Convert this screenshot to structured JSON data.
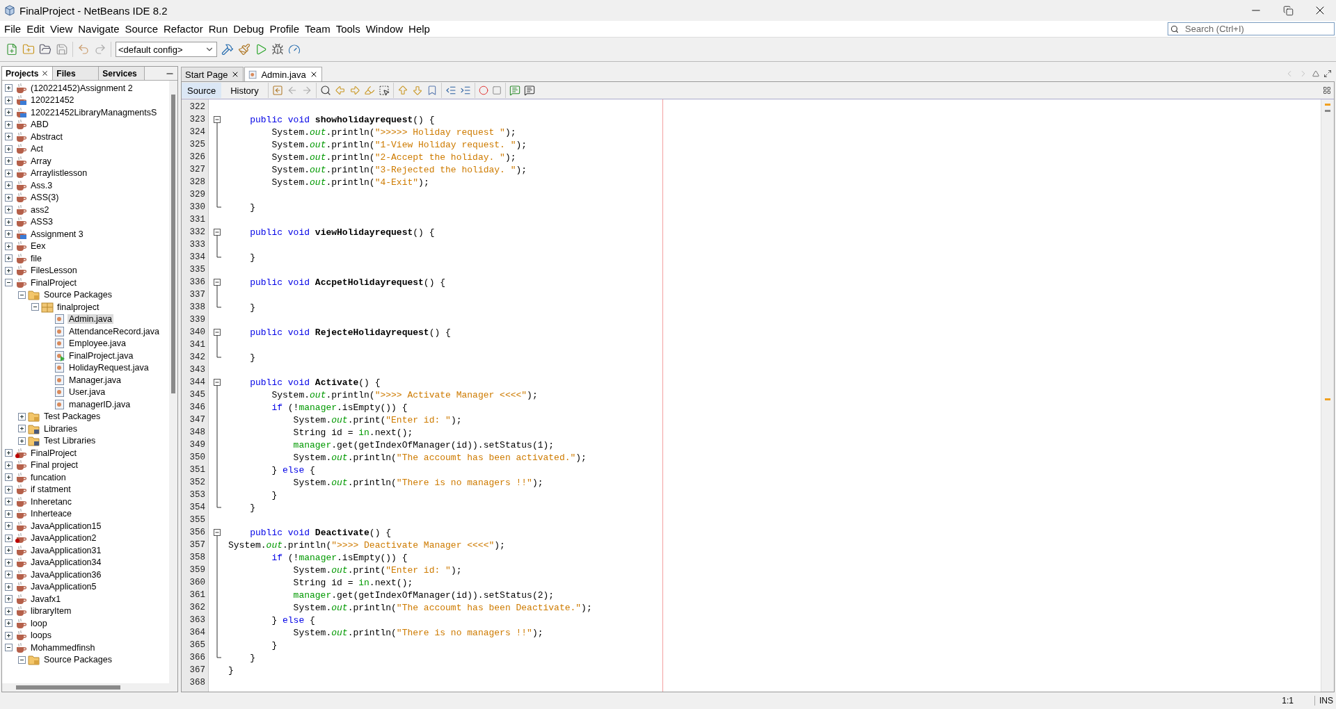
{
  "window": {
    "title": "FinalProject - NetBeans IDE 8.2"
  },
  "menu": [
    "File",
    "Edit",
    "View",
    "Navigate",
    "Source",
    "Refactor",
    "Run",
    "Debug",
    "Profile",
    "Team",
    "Tools",
    "Window",
    "Help"
  ],
  "search": {
    "placeholder": "Search (Ctrl+I)"
  },
  "toolbar": {
    "config": "<default config>"
  },
  "side_tabs": [
    {
      "label": "Projects",
      "selected": true,
      "closable": true
    },
    {
      "label": "Files",
      "selected": false,
      "closable": false
    },
    {
      "label": "Services",
      "selected": false,
      "closable": false
    }
  ],
  "tree": [
    {
      "label": "(120221452)Assignment 2",
      "kind": "project",
      "expanded": false,
      "selected": false
    },
    {
      "label": "120221452",
      "kind": "project-fx",
      "expanded": false,
      "selected": false
    },
    {
      "label": "120221452LibraryManagmentsS",
      "kind": "project-fx",
      "expanded": false,
      "selected": false
    },
    {
      "label": "ABD",
      "kind": "project",
      "expanded": false,
      "selected": false
    },
    {
      "label": "Abstract",
      "kind": "project",
      "expanded": false,
      "selected": false
    },
    {
      "label": "Act",
      "kind": "project",
      "expanded": false,
      "selected": false
    },
    {
      "label": "Array",
      "kind": "project",
      "expanded": false,
      "selected": false
    },
    {
      "label": "Arraylistlesson",
      "kind": "project",
      "expanded": false,
      "selected": false
    },
    {
      "label": "Ass.3",
      "kind": "project",
      "expanded": false,
      "selected": false
    },
    {
      "label": "ASS(3)",
      "kind": "project",
      "expanded": false,
      "selected": false
    },
    {
      "label": "ass2",
      "kind": "project",
      "expanded": false,
      "selected": false
    },
    {
      "label": "ASS3",
      "kind": "project",
      "expanded": false,
      "selected": false
    },
    {
      "label": "Assignment 3",
      "kind": "project-fx",
      "expanded": false,
      "selected": false
    },
    {
      "label": "Eex",
      "kind": "project",
      "expanded": false,
      "selected": false
    },
    {
      "label": "file",
      "kind": "project",
      "expanded": false,
      "selected": false
    },
    {
      "label": "FilesLesson",
      "kind": "project",
      "expanded": false,
      "selected": false
    },
    {
      "label": "FinalProject",
      "kind": "project",
      "expanded": true,
      "selected": false,
      "children": [
        {
          "label": "Source Packages",
          "kind": "source-folder",
          "expanded": true,
          "selected": false,
          "children": [
            {
              "label": "finalproject",
              "kind": "package",
              "expanded": true,
              "selected": false,
              "children": [
                {
                  "label": "Admin.java",
                  "kind": "java-file",
                  "selected": true
                },
                {
                  "label": "AttendanceRecord.java",
                  "kind": "java-file",
                  "selected": false
                },
                {
                  "label": "Employee.java",
                  "kind": "java-file",
                  "selected": false
                },
                {
                  "label": "FinalProject.java",
                  "kind": "main-file",
                  "selected": false
                },
                {
                  "label": "HolidayRequest.java",
                  "kind": "java-file",
                  "selected": false
                },
                {
                  "label": "Manager.java",
                  "kind": "java-file",
                  "selected": false
                },
                {
                  "label": "User.java",
                  "kind": "java-file",
                  "selected": false
                },
                {
                  "label": "managerID.java",
                  "kind": "java-file",
                  "selected": false
                }
              ]
            }
          ]
        },
        {
          "label": "Test Packages",
          "kind": "source-folder",
          "expanded": false,
          "selected": false
        },
        {
          "label": "Libraries",
          "kind": "library-folder",
          "expanded": false,
          "selected": false
        },
        {
          "label": "Test Libraries",
          "kind": "library-folder",
          "expanded": false,
          "selected": false
        }
      ]
    },
    {
      "label": "FinalProject",
      "kind": "project-error",
      "expanded": false,
      "selected": false
    },
    {
      "label": "Final project",
      "kind": "project",
      "expanded": false,
      "selected": false
    },
    {
      "label": "funcation",
      "kind": "project",
      "expanded": false,
      "selected": false
    },
    {
      "label": "if statment",
      "kind": "project",
      "expanded": false,
      "selected": false
    },
    {
      "label": "Inheretanc",
      "kind": "project",
      "expanded": false,
      "selected": false
    },
    {
      "label": "Inherteace",
      "kind": "project",
      "expanded": false,
      "selected": false
    },
    {
      "label": "JavaApplication15",
      "kind": "project",
      "expanded": false,
      "selected": false
    },
    {
      "label": "JavaApplication2",
      "kind": "project-error",
      "expanded": false,
      "selected": false
    },
    {
      "label": "JavaApplication31",
      "kind": "project",
      "expanded": false,
      "selected": false
    },
    {
      "label": "JavaApplication34",
      "kind": "project",
      "expanded": false,
      "selected": false
    },
    {
      "label": "JavaApplication36",
      "kind": "project",
      "expanded": false,
      "selected": false
    },
    {
      "label": "JavaApplication5",
      "kind": "project",
      "expanded": false,
      "selected": false
    },
    {
      "label": "Javafx1",
      "kind": "project",
      "expanded": false,
      "selected": false
    },
    {
      "label": "libraryItem",
      "kind": "project",
      "expanded": false,
      "selected": false
    },
    {
      "label": "loop",
      "kind": "project",
      "expanded": false,
      "selected": false
    },
    {
      "label": "loops",
      "kind": "project",
      "expanded": false,
      "selected": false
    },
    {
      "label": "Mohammedfinsh",
      "kind": "project",
      "expanded": true,
      "selected": false,
      "children": [
        {
          "label": "Source Packages",
          "kind": "source-folder",
          "expanded": true,
          "selected": false
        }
      ]
    }
  ],
  "editor_tabs": [
    {
      "label": "Start Page",
      "selected": false,
      "kind": "page"
    },
    {
      "label": "Admin.java",
      "selected": true,
      "kind": "java"
    }
  ],
  "view_toggles": [
    {
      "label": "Source",
      "selected": true
    },
    {
      "label": "History",
      "selected": false
    }
  ],
  "code_lines": [
    {
      "number": "322",
      "kind": "plain"
    },
    {
      "number": "323",
      "kind": "fold-start",
      "tokens": [
        {
          "kind": "keyword",
          "text": "    public void"
        },
        {
          "kind": "method",
          "text": " showholidayrequest"
        },
        {
          "kind": "plain",
          "text": "() {"
        }
      ]
    },
    {
      "number": "324",
      "kind": "fold-body",
      "tokens": [
        {
          "kind": "plain",
          "text": "        System."
        },
        {
          "kind": "static",
          "text": "out"
        },
        {
          "kind": "plain",
          "text": ".println("
        },
        {
          "kind": "string",
          "text": "\">>>>> Holiday request \""
        },
        {
          "kind": "plain",
          "text": ");"
        }
      ]
    },
    {
      "number": "325",
      "kind": "fold-body",
      "tokens": [
        {
          "kind": "plain",
          "text": "        System."
        },
        {
          "kind": "static",
          "text": "out"
        },
        {
          "kind": "plain",
          "text": ".println("
        },
        {
          "kind": "string",
          "text": "\"1-View Holiday request. \""
        },
        {
          "kind": "plain",
          "text": ");"
        }
      ]
    },
    {
      "number": "326",
      "kind": "fold-body",
      "tokens": [
        {
          "kind": "plain",
          "text": "        System."
        },
        {
          "kind": "static",
          "text": "out"
        },
        {
          "kind": "plain",
          "text": ".println("
        },
        {
          "kind": "string",
          "text": "\"2-Accept the holiday. \""
        },
        {
          "kind": "plain",
          "text": ");"
        }
      ]
    },
    {
      "number": "327",
      "kind": "fold-body",
      "tokens": [
        {
          "kind": "plain",
          "text": "        System."
        },
        {
          "kind": "static",
          "text": "out"
        },
        {
          "kind": "plain",
          "text": ".println("
        },
        {
          "kind": "string",
          "text": "\"3-Rejected the holiday. \""
        },
        {
          "kind": "plain",
          "text": ");"
        }
      ]
    },
    {
      "number": "328",
      "kind": "fold-body",
      "tokens": [
        {
          "kind": "plain",
          "text": "        System."
        },
        {
          "kind": "static",
          "text": "out"
        },
        {
          "kind": "plain",
          "text": ".println("
        },
        {
          "kind": "string",
          "text": "\"4-Exit\""
        },
        {
          "kind": "plain",
          "text": ");"
        }
      ]
    },
    {
      "number": "329",
      "kind": "fold-body"
    },
    {
      "number": "330",
      "kind": "fold-end",
      "tokens": [
        {
          "kind": "plain",
          "text": "    }"
        }
      ]
    },
    {
      "number": "331",
      "kind": "plain"
    },
    {
      "number": "332",
      "kind": "fold-start",
      "tokens": [
        {
          "kind": "keyword",
          "text": "    public void"
        },
        {
          "kind": "method",
          "text": " viewHolidayrequest"
        },
        {
          "kind": "plain",
          "text": "() {"
        }
      ]
    },
    {
      "number": "333",
      "kind": "fold-body"
    },
    {
      "number": "334",
      "kind": "fold-end",
      "tokens": [
        {
          "kind": "plain",
          "text": "    }"
        }
      ]
    },
    {
      "number": "335",
      "kind": "plain"
    },
    {
      "number": "336",
      "kind": "fold-start",
      "tokens": [
        {
          "kind": "keyword",
          "text": "    public void"
        },
        {
          "kind": "method",
          "text": " AccpetHolidayrequest"
        },
        {
          "kind": "plain",
          "text": "() {"
        }
      ]
    },
    {
      "number": "337",
      "kind": "fold-body"
    },
    {
      "number": "338",
      "kind": "fold-end",
      "tokens": [
        {
          "kind": "plain",
          "text": "    }"
        }
      ]
    },
    {
      "number": "339",
      "kind": "plain"
    },
    {
      "number": "340",
      "kind": "fold-start",
      "tokens": [
        {
          "kind": "keyword",
          "text": "    public void"
        },
        {
          "kind": "method",
          "text": " RejecteHolidayrequest"
        },
        {
          "kind": "plain",
          "text": "() {"
        }
      ]
    },
    {
      "number": "341",
      "kind": "fold-body"
    },
    {
      "number": "342",
      "kind": "fold-end",
      "tokens": [
        {
          "kind": "plain",
          "text": "    }"
        }
      ]
    },
    {
      "number": "343",
      "kind": "plain"
    },
    {
      "number": "344",
      "kind": "fold-start",
      "tokens": [
        {
          "kind": "keyword",
          "text": "    public void"
        },
        {
          "kind": "method",
          "text": " Activate"
        },
        {
          "kind": "plain",
          "text": "() {"
        }
      ]
    },
    {
      "number": "345",
      "kind": "fold-body",
      "tokens": [
        {
          "kind": "plain",
          "text": "        System."
        },
        {
          "kind": "static",
          "text": "out"
        },
        {
          "kind": "plain",
          "text": ".println("
        },
        {
          "kind": "string",
          "text": "\">>>> Activate Manager <<<<\""
        },
        {
          "kind": "plain",
          "text": ");"
        }
      ]
    },
    {
      "number": "346",
      "kind": "fold-body",
      "tokens": [
        {
          "kind": "keyword",
          "text": "        if"
        },
        {
          "kind": "plain",
          "text": " (!"
        },
        {
          "kind": "field",
          "text": "manager"
        },
        {
          "kind": "plain",
          "text": ".isEmpty()) {"
        }
      ]
    },
    {
      "number": "347",
      "kind": "fold-body",
      "tokens": [
        {
          "kind": "plain",
          "text": "            System."
        },
        {
          "kind": "static",
          "text": "out"
        },
        {
          "kind": "plain",
          "text": ".print("
        },
        {
          "kind": "string",
          "text": "\"Enter id: \""
        },
        {
          "kind": "plain",
          "text": ");"
        }
      ]
    },
    {
      "number": "348",
      "kind": "fold-body",
      "tokens": [
        {
          "kind": "plain",
          "text": "            String id = "
        },
        {
          "kind": "field",
          "text": "in"
        },
        {
          "kind": "plain",
          "text": ".next();"
        }
      ]
    },
    {
      "number": "349",
      "kind": "fold-body",
      "tokens": [
        {
          "kind": "field",
          "text": "            manager"
        },
        {
          "kind": "plain",
          "text": ".get(getIndexOfManager(id)).setStatus(1);"
        }
      ]
    },
    {
      "number": "350",
      "kind": "fold-body",
      "tokens": [
        {
          "kind": "plain",
          "text": "            System."
        },
        {
          "kind": "static",
          "text": "out"
        },
        {
          "kind": "plain",
          "text": ".println("
        },
        {
          "kind": "string",
          "text": "\"The accoumt has been activated.\""
        },
        {
          "kind": "plain",
          "text": ");"
        }
      ]
    },
    {
      "number": "351",
      "kind": "fold-body",
      "tokens": [
        {
          "kind": "plain",
          "text": "        }"
        },
        {
          "kind": "keyword",
          "text": " else"
        },
        {
          "kind": "plain",
          "text": " {"
        }
      ]
    },
    {
      "number": "352",
      "kind": "fold-body",
      "tokens": [
        {
          "kind": "plain",
          "text": "            System."
        },
        {
          "kind": "static",
          "text": "out"
        },
        {
          "kind": "plain",
          "text": ".println("
        },
        {
          "kind": "string",
          "text": "\"There is no managers !!\""
        },
        {
          "kind": "plain",
          "text": ");"
        }
      ]
    },
    {
      "number": "353",
      "kind": "fold-body",
      "tokens": [
        {
          "kind": "plain",
          "text": "        }"
        }
      ]
    },
    {
      "number": "354",
      "kind": "fold-end",
      "tokens": [
        {
          "kind": "plain",
          "text": "    }"
        }
      ]
    },
    {
      "number": "355",
      "kind": "plain"
    },
    {
      "number": "356",
      "kind": "fold-start",
      "tokens": [
        {
          "kind": "keyword",
          "text": "    public void"
        },
        {
          "kind": "method",
          "text": " Deactivate"
        },
        {
          "kind": "plain",
          "text": "() {"
        }
      ]
    },
    {
      "number": "357",
      "kind": "fold-body",
      "tokens": [
        {
          "kind": "plain",
          "text": "System."
        },
        {
          "kind": "static",
          "text": "out"
        },
        {
          "kind": "plain",
          "text": ".println("
        },
        {
          "kind": "string",
          "text": "\">>>> Deactivate Manager <<<<\""
        },
        {
          "kind": "plain",
          "text": ");"
        }
      ]
    },
    {
      "number": "358",
      "kind": "fold-body",
      "tokens": [
        {
          "kind": "keyword",
          "text": "        if"
        },
        {
          "kind": "plain",
          "text": " (!"
        },
        {
          "kind": "field",
          "text": "manager"
        },
        {
          "kind": "plain",
          "text": ".isEmpty()) {"
        }
      ]
    },
    {
      "number": "359",
      "kind": "fold-body",
      "tokens": [
        {
          "kind": "plain",
          "text": "            System."
        },
        {
          "kind": "static",
          "text": "out"
        },
        {
          "kind": "plain",
          "text": ".print("
        },
        {
          "kind": "string",
          "text": "\"Enter id: \""
        },
        {
          "kind": "plain",
          "text": ");"
        }
      ]
    },
    {
      "number": "360",
      "kind": "fold-body",
      "tokens": [
        {
          "kind": "plain",
          "text": "            String id = "
        },
        {
          "kind": "field",
          "text": "in"
        },
        {
          "kind": "plain",
          "text": ".next();"
        }
      ]
    },
    {
      "number": "361",
      "kind": "fold-body",
      "tokens": [
        {
          "kind": "field",
          "text": "            manager"
        },
        {
          "kind": "plain",
          "text": ".get(getIndexOfManager(id)).setStatus(2);"
        }
      ]
    },
    {
      "number": "362",
      "kind": "fold-body",
      "tokens": [
        {
          "kind": "plain",
          "text": "            System."
        },
        {
          "kind": "static",
          "text": "out"
        },
        {
          "kind": "plain",
          "text": ".println("
        },
        {
          "kind": "string",
          "text": "\"The accoumt has been Deactivate.\""
        },
        {
          "kind": "plain",
          "text": ");"
        }
      ]
    },
    {
      "number": "363",
      "kind": "fold-body",
      "tokens": [
        {
          "kind": "plain",
          "text": "        }"
        },
        {
          "kind": "keyword",
          "text": " else"
        },
        {
          "kind": "plain",
          "text": " {"
        }
      ]
    },
    {
      "number": "364",
      "kind": "fold-body",
      "tokens": [
        {
          "kind": "plain",
          "text": "            System."
        },
        {
          "kind": "static",
          "text": "out"
        },
        {
          "kind": "plain",
          "text": ".println("
        },
        {
          "kind": "string",
          "text": "\"There is no managers !!\""
        },
        {
          "kind": "plain",
          "text": ");"
        }
      ]
    },
    {
      "number": "365",
      "kind": "fold-body",
      "tokens": [
        {
          "kind": "plain",
          "text": "        }"
        }
      ]
    },
    {
      "number": "366",
      "kind": "fold-end",
      "tokens": [
        {
          "kind": "plain",
          "text": "    }"
        }
      ]
    },
    {
      "number": "367",
      "kind": "plain",
      "tokens": [
        {
          "kind": "plain",
          "text": "}"
        }
      ]
    },
    {
      "number": "368",
      "kind": "plain"
    }
  ],
  "status_bar": {
    "position": "1:1",
    "mode": "INS"
  }
}
